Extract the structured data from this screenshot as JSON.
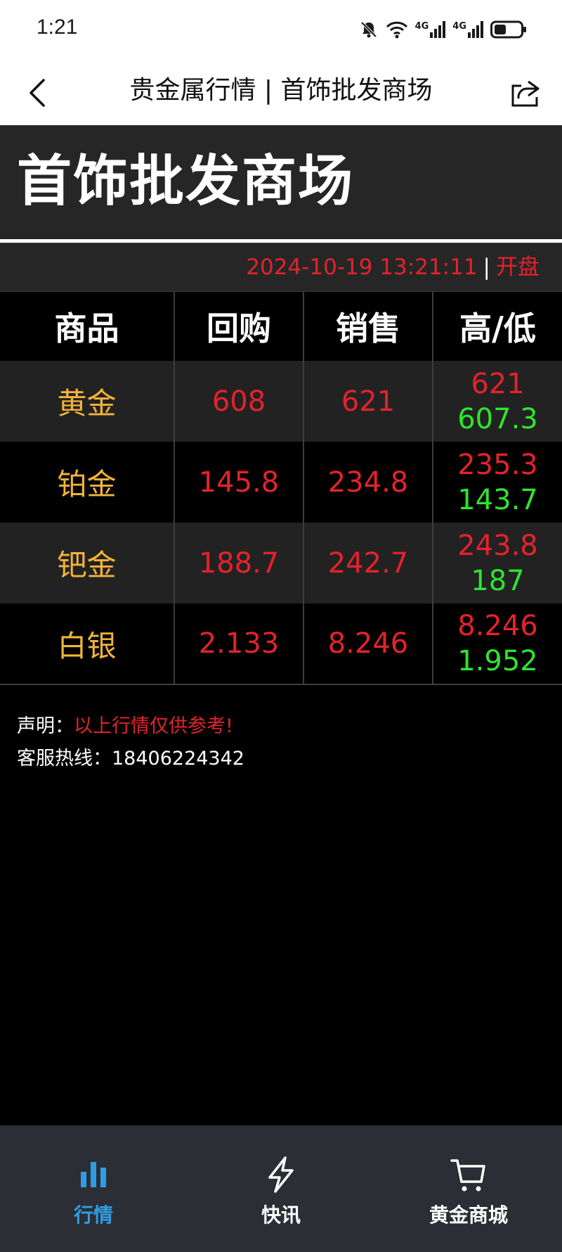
{
  "status_bar": {
    "time": "1:21",
    "signal_label_1": "4G",
    "signal_label_2": "4G"
  },
  "nav": {
    "title": "贵金属行情 | 首饰批发商场"
  },
  "hero": {
    "title": "首饰批发商场"
  },
  "timestamp": {
    "datetime": "2024-10-19 13:21:11",
    "separator": "|",
    "market_status": "开盘"
  },
  "table": {
    "headers": [
      "商品",
      "回购",
      "销售",
      "高/低"
    ],
    "rows": [
      {
        "name": "黄金",
        "buyback": "608",
        "sell": "621",
        "high": "621",
        "low": "607.3"
      },
      {
        "name": "铂金",
        "buyback": "145.8",
        "sell": "234.8",
        "high": "235.3",
        "low": "143.7"
      },
      {
        "name": "钯金",
        "buyback": "188.7",
        "sell": "242.7",
        "high": "243.8",
        "low": "187"
      },
      {
        "name": "白银",
        "buyback": "2.133",
        "sell": "8.246",
        "high": "8.246",
        "low": "1.952"
      }
    ]
  },
  "notes": {
    "disclaimer_label": "声明：",
    "disclaimer_text": "以上行情仅供参考!",
    "hotline_label": "客服热线：",
    "hotline_number": "18406224342"
  },
  "tabbar": {
    "items": [
      {
        "label": "行情",
        "icon": "bar-chart-icon",
        "active": true
      },
      {
        "label": "快讯",
        "icon": "lightning-icon",
        "active": false
      },
      {
        "label": "黄金商城",
        "icon": "cart-icon",
        "active": false
      }
    ]
  },
  "colors": {
    "name_gold": "#f2b33d",
    "price_red": "#e3232b",
    "low_green": "#2ee52e",
    "active_tab_blue": "#2f9de6",
    "tabbar_bg": "#2b2e34"
  }
}
